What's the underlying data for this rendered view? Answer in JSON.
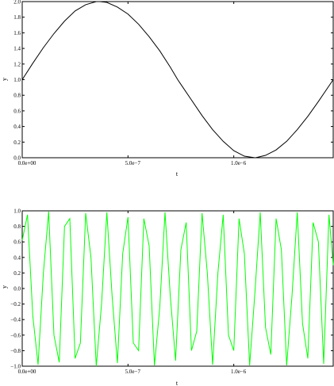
{
  "chart_data": [
    {
      "type": "line",
      "title": "",
      "xlabel": "t",
      "ylabel": "y",
      "xlim": [
        0,
        1.47e-06
      ],
      "ylim": [
        0,
        2.0
      ],
      "x_ticks": [
        0,
        5e-07,
        1e-06
      ],
      "x_tick_labels": [
        "0.0e+00",
        "5.0e−7",
        "1.0e−6"
      ],
      "y_ticks": [
        0,
        0.2,
        0.4,
        0.6,
        0.8,
        1.0,
        1.2,
        1.4,
        1.6,
        1.8,
        2.0
      ],
      "y_tick_labels": [
        "0.0",
        "0.2",
        "0.4",
        "0.6",
        "0.8",
        "1.0",
        "1.2",
        "1.4",
        "1.6",
        "1.8",
        "2.0"
      ],
      "grid": false,
      "series": [
        {
          "color": "#000000",
          "x": [
            0,
            5e-08,
            1e-07,
            1.5e-07,
            2e-07,
            2.5e-07,
            3e-07,
            3.5e-07,
            3.68e-07,
            4e-07,
            4.5e-07,
            5e-07,
            5.5e-07,
            6e-07,
            6.5e-07,
            7e-07,
            7.35e-07,
            7.5e-07,
            8e-07,
            8.5e-07,
            9e-07,
            9.5e-07,
            1e-06,
            1.05e-06,
            1.1e-06,
            1.103e-06,
            1.15e-06,
            1.2e-06,
            1.25e-06,
            1.3e-06,
            1.35e-06,
            1.4e-06,
            1.45e-06,
            1.47e-06
          ],
          "values": [
            1.0,
            1.21,
            1.41,
            1.59,
            1.75,
            1.88,
            1.96,
            2.0,
            2.0,
            1.99,
            1.93,
            1.84,
            1.71,
            1.55,
            1.37,
            1.16,
            1.0,
            0.94,
            0.74,
            0.54,
            0.36,
            0.21,
            0.09,
            0.02,
            0.0,
            0.0,
            0.03,
            0.1,
            0.21,
            0.36,
            0.53,
            0.72,
            0.92,
            1.0
          ]
        }
      ]
    },
    {
      "type": "line",
      "title": "",
      "xlabel": "t",
      "ylabel": "y",
      "xlim": [
        0,
        1.47e-06
      ],
      "ylim": [
        -1.0,
        1.0
      ],
      "x_ticks": [
        0,
        5e-07,
        1e-06
      ],
      "x_tick_labels": [
        "0.0e+00",
        "5.0e−7",
        "1.0e−6"
      ],
      "y_ticks": [
        -1.0,
        -0.8,
        -0.6,
        -0.4,
        -0.2,
        0.0,
        0.2,
        0.4,
        0.6,
        0.8,
        1.0
      ],
      "y_tick_labels": [
        "−1.0",
        "−0.8",
        "−0.6",
        "−0.4",
        "−0.2",
        "0.0",
        "0.2",
        "0.4",
        "0.6",
        "0.8",
        "1.0"
      ],
      "grid": false,
      "series": [
        {
          "color": "#00ff00",
          "description_of_signal": "",
          "x": [
            0,
            2.5e-08,
            5e-08,
            7.5e-08,
            1e-07,
            1.25e-07,
            1.5e-07,
            1.75e-07,
            2e-07,
            2.25e-07,
            2.5e-07,
            2.75e-07,
            3e-07,
            3.25e-07,
            3.5e-07,
            3.75e-07,
            4e-07,
            4.25e-07,
            4.5e-07,
            4.75e-07,
            5e-07,
            5.25e-07,
            5.5e-07,
            5.75e-07,
            6e-07,
            6.25e-07,
            6.5e-07,
            6.75e-07,
            7e-07,
            7.25e-07,
            7.5e-07,
            7.75e-07,
            8e-07,
            8.25e-07,
            8.5e-07,
            8.75e-07,
            9e-07,
            9.25e-07,
            9.5e-07,
            9.75e-07,
            1e-06,
            1.025e-06,
            1.05e-06,
            1.075e-06,
            1.1e-06,
            1.125e-06,
            1.15e-06,
            1.175e-06,
            1.2e-06,
            1.225e-06,
            1.25e-06,
            1.275e-06,
            1.3e-06,
            1.325e-06,
            1.35e-06,
            1.375e-06,
            1.4e-06,
            1.425e-06,
            1.45e-06,
            1.47e-06
          ],
          "values": [
            0.62,
            0.95,
            -0.35,
            -0.98,
            0.2,
            0.99,
            -0.6,
            -0.95,
            0.8,
            0.9,
            -0.9,
            -0.7,
            0.97,
            0.4,
            -1.0,
            -0.2,
            0.98,
            -0.1,
            -0.96,
            0.45,
            0.92,
            -0.7,
            -0.8,
            0.9,
            0.55,
            -0.99,
            -0.25,
            0.98,
            -0.1,
            -0.93,
            0.5,
            0.85,
            -0.8,
            -0.55,
            0.97,
            0.2,
            -0.98,
            0.2,
            0.95,
            -0.6,
            -0.8,
            0.9,
            0.45,
            -0.99,
            -0.05,
            0.98,
            -0.5,
            -0.85,
            0.9,
            0.5,
            -0.99,
            -0.1,
            0.98,
            -0.45,
            -0.9,
            0.85,
            0.6,
            -0.97,
            0.95,
            0.3
          ]
        }
      ]
    }
  ]
}
